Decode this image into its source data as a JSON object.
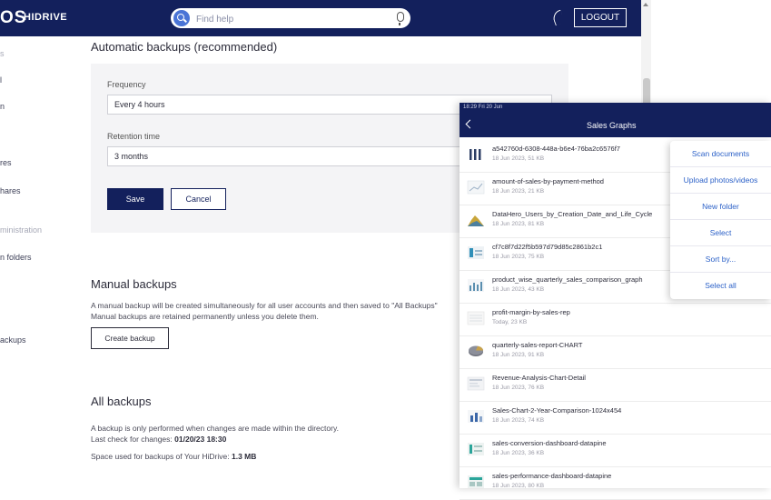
{
  "brand": {
    "logo_text": "OS",
    "logo_sub": "HIDRIVE"
  },
  "header": {
    "search_placeholder": "Find help",
    "logout_label": "LOGOUT"
  },
  "sidebar": {
    "fragments": [
      {
        "text": "s",
        "muted": true
      },
      {
        "text": "l",
        "muted": false
      },
      {
        "text": "n",
        "muted": false
      },
      {
        "text": "res",
        "muted": false
      },
      {
        "text": "hares",
        "muted": false
      },
      {
        "text": "ministration",
        "muted": true
      },
      {
        "text": "n folders",
        "muted": false
      },
      {
        "text": "ackups",
        "muted": false
      }
    ]
  },
  "auto": {
    "heading": "Automatic backups (recommended)",
    "frequency_label": "Frequency",
    "frequency_value": "Every 4 hours",
    "retention_label": "Retention time",
    "retention_value": "3 months",
    "save_label": "Save",
    "cancel_label": "Cancel"
  },
  "manual": {
    "heading": "Manual backups",
    "line1": "A manual backup will be created simultaneously for all user accounts and then saved to \"All Backups\"",
    "line2": "Manual backups are retained permanently unless you delete them.",
    "create_label": "Create backup"
  },
  "all": {
    "heading": "All backups",
    "line1": "A backup is only performed when changes are made within the directory.",
    "last_check_label": "Last check for changes:",
    "last_check_value": "01/20/23 18:30",
    "space_label": "Space used for backups of Your HiDrive:",
    "space_value": "1.3 MB"
  },
  "tablet": {
    "status_text": "18:29  Fri 20 Jun",
    "title": "Sales Graphs",
    "files": [
      {
        "name": "a542760d-6308-448a-b6e4-76ba2c6576f7",
        "meta": "18 Jun 2023, 51 KB",
        "icon": "bars-thumbnail-icon"
      },
      {
        "name": "amount-of-sales-by-payment-method",
        "meta": "18 Jun 2023, 21 KB",
        "icon": "chart-thumbnail-icon"
      },
      {
        "name": "DataHero_Users_by_Creation_Date_and_Life_Cycle",
        "meta": "18 Jun 2023, 81 KB",
        "icon": "area-chart-thumbnail-icon"
      },
      {
        "name": "cf7c8f7d22f5b597d79d85c2861b2c1",
        "meta": "18 Jun 2023, 75 KB",
        "icon": "dashboard-thumbnail-icon"
      },
      {
        "name": "product_wise_quarterly_sales_comparison_graph",
        "meta": "18 Jun 2023, 43 KB",
        "icon": "bar-chart-thumbnail-icon"
      },
      {
        "name": "profit-margin-by-sales-rep",
        "meta": "Today, 23 KB",
        "icon": "table-thumbnail-icon"
      },
      {
        "name": "quarterly-sales-report-CHART",
        "meta": "18 Jun 2023, 91 KB",
        "icon": "pie-thumbnail-icon"
      },
      {
        "name": "Revenue-Analysis-Chart-Detail",
        "meta": "18 Jun 2023, 76 KB",
        "icon": "report-thumbnail-icon"
      },
      {
        "name": "Sales-Chart-2-Year-Comparison-1024x454",
        "meta": "18 Jun 2023, 74 KB",
        "icon": "column-chart-thumbnail-icon"
      },
      {
        "name": "sales-conversion-dashboard-datapine",
        "meta": "18 Jun 2023, 36 KB",
        "icon": "dashboard-thumbnail-icon"
      },
      {
        "name": "sales-performance-dashboard-datapine",
        "meta": "18 Jun 2023, 80 KB",
        "icon": "dashboard-thumbnail-icon"
      }
    ],
    "menu": [
      "Scan documents",
      "Upload photos/videos",
      "New folder",
      "Select",
      "Sort by...",
      "Select all"
    ]
  }
}
